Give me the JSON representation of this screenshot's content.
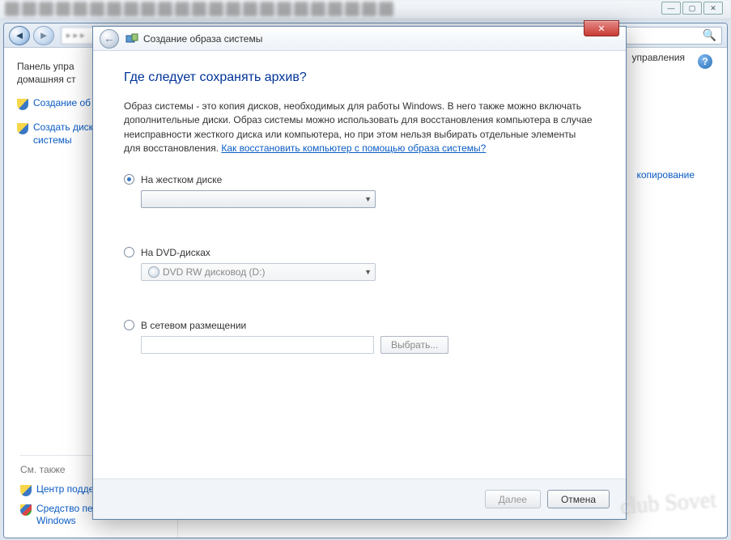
{
  "background": {
    "sidebar": {
      "title_line1": "Панель упра",
      "title_line2": "домашняя ст",
      "link1": "Создание об",
      "link2_line1": "Создать диск",
      "link2_line2": "системы",
      "see_also": "См. также",
      "bottom1": "Центр подде",
      "bottom2_line1": "Средство пе",
      "bottom2_line2": "Windows"
    },
    "addr_right": "управления",
    "main_right_link": "копирование"
  },
  "wizard": {
    "title": "Создание образа системы",
    "heading": "Где следует сохранять архив?",
    "description": "Образ системы - это копия дисков, необходимых для работы Windows. В него также можно включать дополнительные диски. Образ системы можно использовать для восстановления компьютера в случае неисправности жесткого диска или компьютера, но при этом нельзя выбирать отдельные элементы для восстановления. ",
    "description_link": "Как восстановить компьютер с помощью образа системы?",
    "options": {
      "hdd": {
        "label": "На жестком диске",
        "value": ""
      },
      "dvd": {
        "label": "На DVD-дисках",
        "value": "DVD RW дисковод (D:)"
      },
      "net": {
        "label": "В сетевом размещении",
        "browse": "Выбрать..."
      }
    },
    "buttons": {
      "next": "Далее",
      "cancel": "Отмена"
    }
  },
  "watermark": "club Sovet"
}
